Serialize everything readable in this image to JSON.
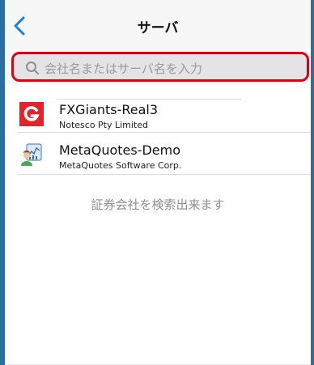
{
  "nav": {
    "title": "サーバ",
    "back_icon": "chevron-left-icon",
    "accent_color": "#1a7ee8"
  },
  "search": {
    "placeholder": "会社名またはサーバ名を入力",
    "value": "",
    "icon": "search-icon",
    "highlight_color": "#e00010"
  },
  "servers": [
    {
      "name": "FXGiants-Real3",
      "company": "Notesco Pty Limited",
      "icon": "fxgiants-logo-icon",
      "icon_color": "#e3222c"
    },
    {
      "name": "MetaQuotes-Demo",
      "company": "MetaQuotes Software Corp.",
      "icon": "metaquotes-logo-icon"
    }
  ],
  "hint": "証券会社を検索出来ます",
  "colors": {
    "side_bar": "#2e6e9e",
    "nav_bg": "#f7f7f7",
    "field_bg": "#e4e4e6"
  }
}
